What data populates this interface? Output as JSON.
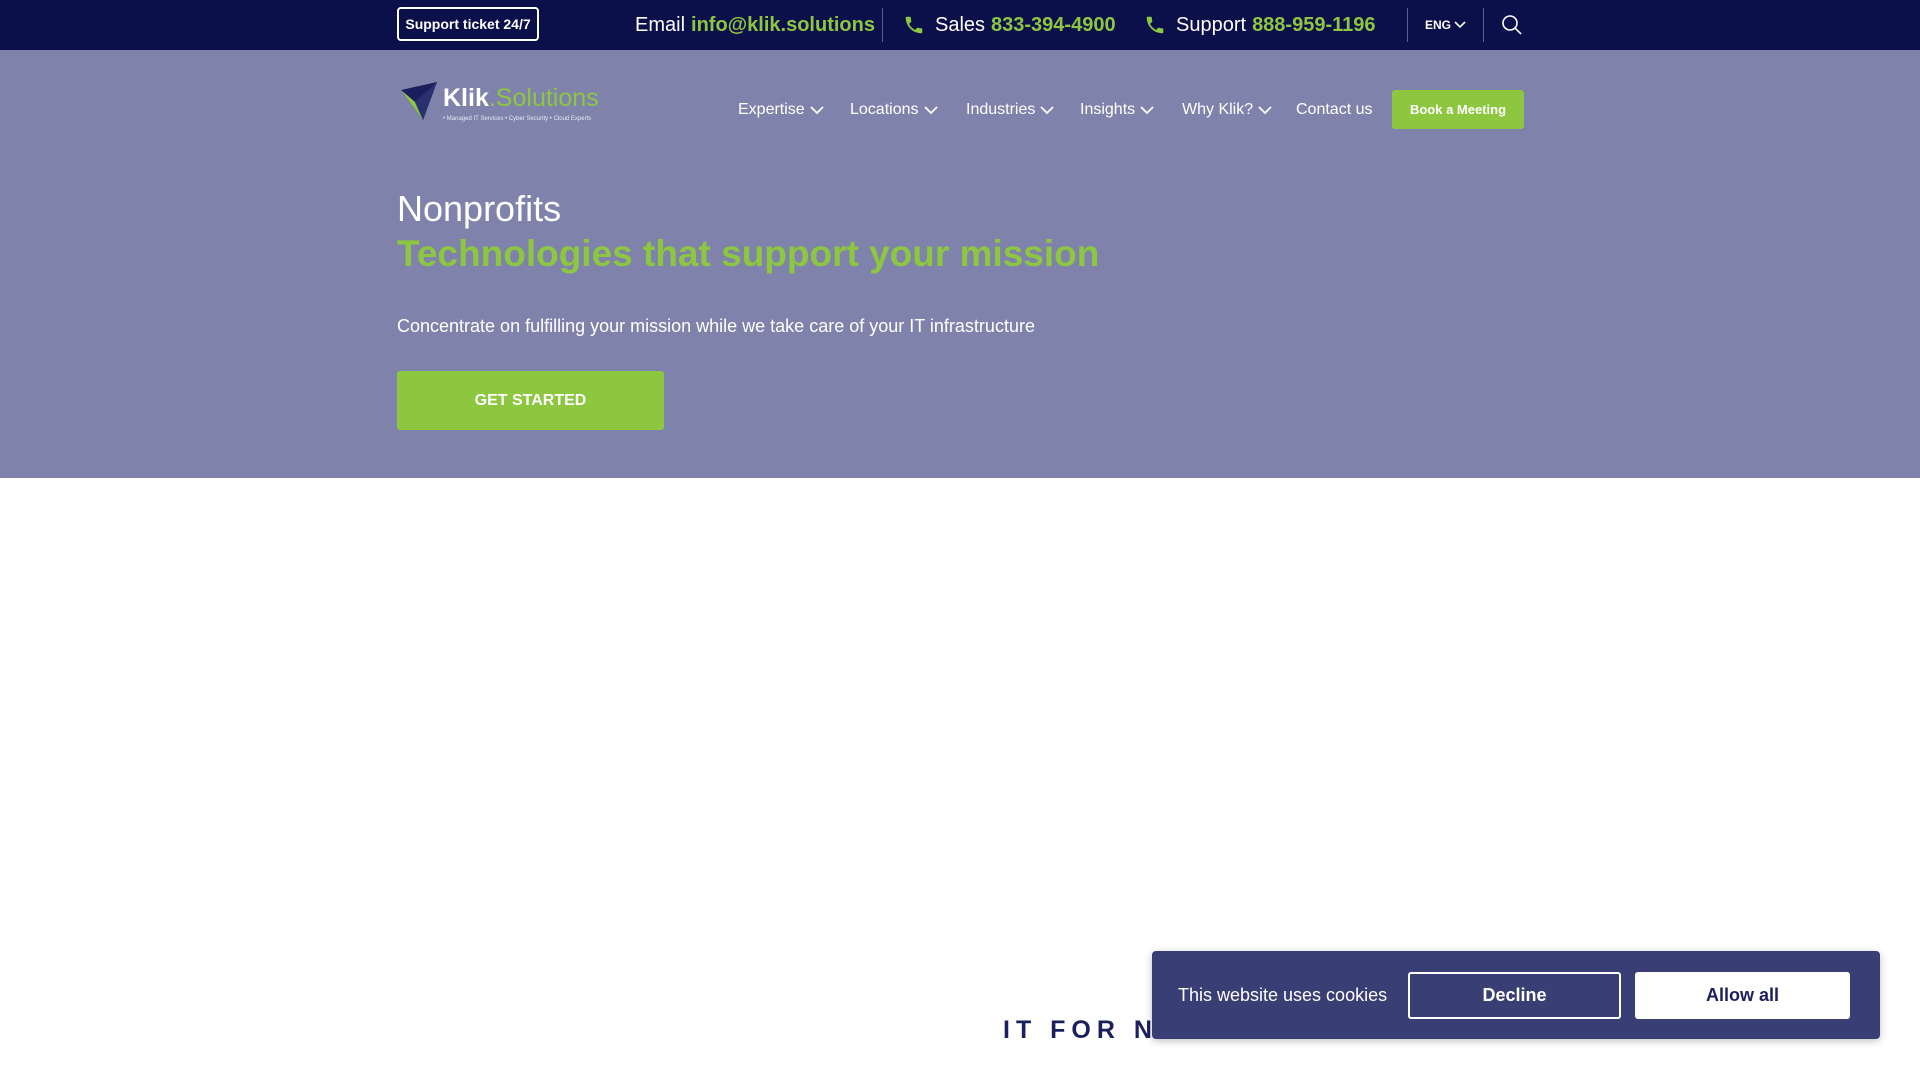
{
  "topbar": {
    "support_ticket": "Support ticket 24/7",
    "email_label": "Email",
    "email_value": "info@klik.solutions",
    "sales_label": "Sales",
    "sales_value": "833-394-4900",
    "support_label": "Support",
    "support_value": "888-959-1196",
    "language": "ENG"
  },
  "logo": {
    "name_part1": "Klik",
    "name_part2": ".Solutions",
    "tagline": "• Managed IT Services • Cyber Security • Cloud Experts"
  },
  "nav": {
    "items": [
      {
        "label": "Expertise"
      },
      {
        "label": "Locations"
      },
      {
        "label": "Industries"
      },
      {
        "label": "Insights"
      },
      {
        "label": "Why Klik?"
      },
      {
        "label": "Contact us"
      }
    ],
    "book_button": "Book a Meeting"
  },
  "hero": {
    "title": "Nonprofits",
    "subtitle": "Technologies that support your mission",
    "description": "Concentrate on fulfilling your mission while we take care of your IT infrastructure",
    "cta": "GET STARTED"
  },
  "section": {
    "heading": "IT FOR NONPROFITS"
  },
  "cookie_banner": {
    "text": "This website uses cookies",
    "decline": "Decline",
    "allow_all": "Allow all"
  },
  "colors": {
    "topbar_bg": "#0b0f4a",
    "hero_bg": "#7f83ab",
    "accent_green": "#8dc63f",
    "cookie_bg": "#393e75"
  },
  "icons": [
    "phone-icon",
    "chevron-down-icon",
    "search-icon",
    "logo-mark-icon"
  ]
}
